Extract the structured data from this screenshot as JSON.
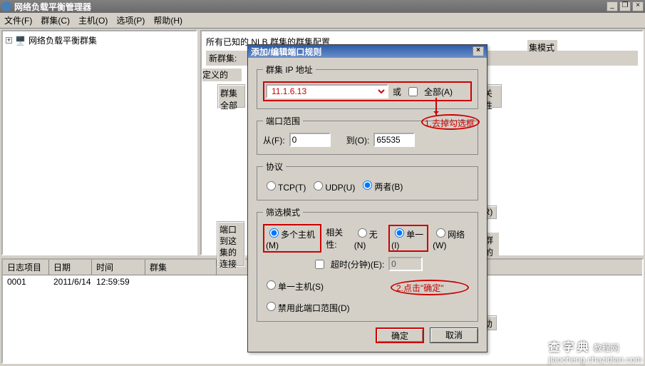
{
  "window": {
    "title": "网络负载平衡管理器",
    "min": "_",
    "restore": "❐",
    "close": "×"
  },
  "menu": {
    "file": "文件(F)",
    "cluster": "群集(C)",
    "host": "主机(O)",
    "options": "选项(P)",
    "help": "帮助(H)"
  },
  "tree": {
    "root": "网络负载平衡群集",
    "exp": "+"
  },
  "right": {
    "header": "所有已知的 NLB 群集的群集配置",
    "newcluster_lbl": "新群集:",
    "col_mode": "集模式"
  },
  "bg": {
    "define": "定义的",
    "cluster_lbl": "群集",
    "all_lbl": "全部",
    "port": "端口",
    "sel1": "到这",
    "sel2": "集的",
    "sel3": "连接",
    "col_attr": "关性",
    "btn_r": "(R)",
    "group_host": "该群",
    "group_host2": "机的",
    "help_btn": "助"
  },
  "dialog": {
    "title": "添加/编辑端口规则",
    "close": "×",
    "ip_legend": "群集 IP 地址",
    "ip_value": "11.1.6.13",
    "or": "或",
    "all_chk": "全部(A)",
    "range_legend": "端口范围",
    "from_lbl": "从(F):",
    "from_val": "0",
    "to_lbl": "到(O):",
    "to_val": "65535",
    "proto_legend": "协议",
    "tcp": "TCP(T)",
    "udp": "UDP(U)",
    "both": "两者(B)",
    "filter_legend": "筛选模式",
    "multi": "多个主机(M)",
    "affinity_lbl": "相关性:",
    "aff_none": "无(N)",
    "aff_single": "单一(I)",
    "aff_net": "网络(W)",
    "timeout_chk": "超时(分钟)(E):",
    "timeout_val": "0",
    "single_host": "单一主机(S)",
    "disable": "禁用此端口范围(D)",
    "ok": "确定",
    "cancel": "取消"
  },
  "annot": {
    "step1": "1.去掉勾选框",
    "step2": "2.点击\"确定\""
  },
  "log": {
    "h_item": "日志项目",
    "h_date": "日期",
    "h_time": "时间",
    "h_cluster": "群集",
    "r_item": "0001",
    "r_date": "2011/6/14",
    "r_time": "12:59:59"
  },
  "watermark": {
    "site": "查字典",
    "url": "jiaocheng.chazidian.com",
    "sub": "教程网"
  }
}
